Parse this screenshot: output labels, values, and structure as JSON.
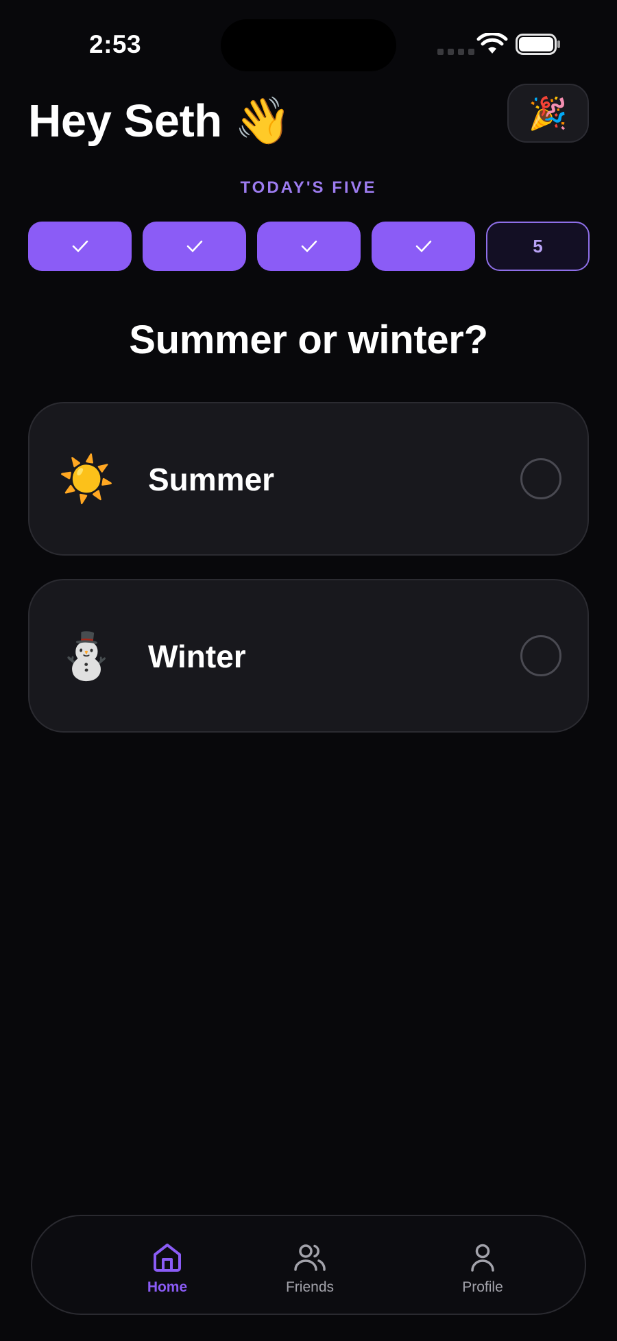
{
  "status_bar": {
    "time": "2:53"
  },
  "header": {
    "greeting": "Hey Seth 👋",
    "party_icon": "🎉"
  },
  "section_label": "TODAY'S FIVE",
  "progress": {
    "completed": 4,
    "total": 5,
    "current_label": "5"
  },
  "question": "Summer or winter?",
  "options": [
    {
      "emoji": "☀️",
      "label": "Summer",
      "selected": false
    },
    {
      "emoji": "⛄",
      "label": "Winter",
      "selected": false
    }
  ],
  "tabs": [
    {
      "label": "Home",
      "icon": "home-icon",
      "active": true
    },
    {
      "label": "Friends",
      "icon": "friends-icon",
      "active": false
    },
    {
      "label": "Profile",
      "icon": "profile-icon",
      "active": false
    }
  ],
  "colors": {
    "accent": "#8b5cf6",
    "background": "#08080b",
    "card": "#18181d"
  }
}
